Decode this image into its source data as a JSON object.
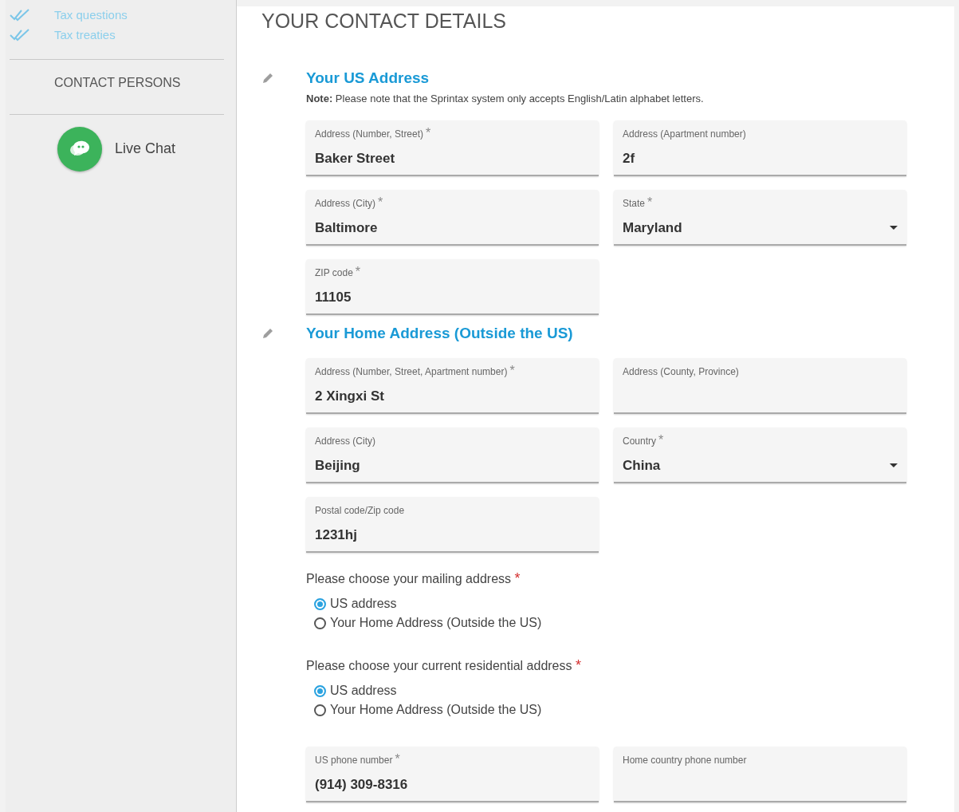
{
  "sidebar": {
    "nav_items": [
      {
        "label": "Tax questions"
      },
      {
        "label": "Tax treaties"
      }
    ],
    "contact_heading": "CONTACT PERSONS",
    "live_chat": {
      "label": "Live Chat"
    }
  },
  "page_title": "YOUR CONTACT DETAILS",
  "sections": [
    {
      "title": "Your US Address",
      "note_label": "Note:",
      "note": "Please note that the Sprintax system only accepts English/Latin alphabet letters.",
      "fields": [
        {
          "kind": "text",
          "label": "Address (Number, Street)",
          "mark": "*",
          "value": "Baker Street"
        },
        {
          "kind": "text",
          "label": "Address (Apartment number)",
          "value": "2f"
        },
        {
          "kind": "text",
          "label": "Address (City)",
          "mark": "*",
          "value": "Baltimore"
        },
        {
          "kind": "select",
          "label": "State",
          "mark": "*",
          "value": "Maryland"
        },
        {
          "kind": "text",
          "label": "ZIP code",
          "mark": "*",
          "value": "11105"
        }
      ]
    },
    {
      "title": "Your Home Address (Outside the US)",
      "fields": [
        {
          "kind": "text",
          "label": "Address (Number, Street, Apartment number)",
          "mark": "*",
          "value": "2 Xingxi St"
        },
        {
          "kind": "text",
          "label": "Address (County, Province)"
        },
        {
          "kind": "text",
          "label": "Address (City)",
          "value": "Beijing"
        },
        {
          "kind": "select",
          "label": "Country",
          "mark": "*",
          "value": "China"
        },
        {
          "kind": "text",
          "label": "Postal code/Zip code",
          "value": "1231hj"
        }
      ]
    }
  ],
  "radio_groups": [
    {
      "question": "Please choose your mailing address",
      "mark": "*",
      "options": [
        {
          "label": "US address",
          "selected": true
        },
        {
          "label": "Your Home Address (Outside the US)",
          "selected": false
        }
      ]
    },
    {
      "question": "Please choose your current residential address",
      "mark": "*",
      "options": [
        {
          "label": "US address",
          "selected": true
        },
        {
          "label": "Your Home Address (Outside the US)",
          "selected": false
        }
      ]
    }
  ],
  "phone_fields": [
    {
      "label": "US phone number",
      "mark": "*",
      "value": "(914) 309-8316"
    },
    {
      "label": "Home country phone number"
    }
  ]
}
